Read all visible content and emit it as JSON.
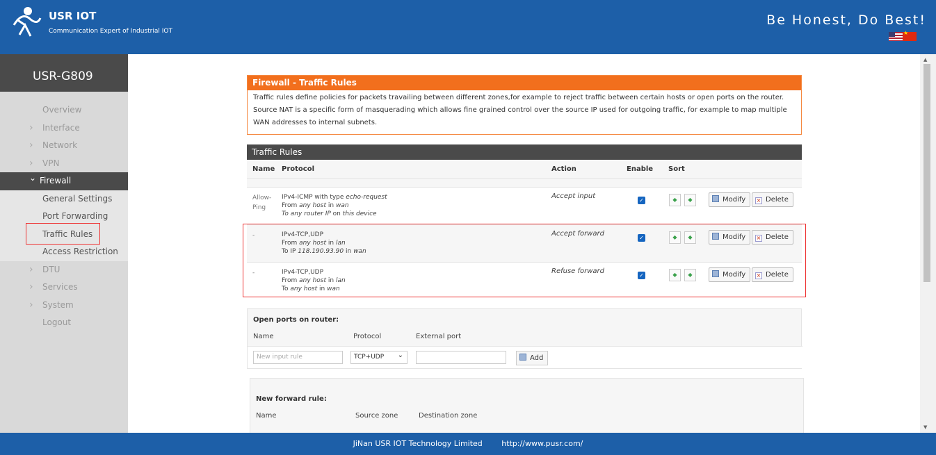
{
  "header": {
    "brand": "USR IOT",
    "subtitle": "Communication Expert of Industrial IOT",
    "slogan": "Be Honest, Do Best!"
  },
  "sidebar": {
    "device": "USR-G809",
    "items": [
      {
        "label": "Overview"
      },
      {
        "label": "Interface"
      },
      {
        "label": "Network"
      },
      {
        "label": "VPN"
      },
      {
        "label": "Firewall"
      }
    ],
    "firewall_sub": [
      {
        "label": "General Settings"
      },
      {
        "label": "Port Forwarding"
      },
      {
        "label": "Traffic Rules"
      },
      {
        "label": "Access Restriction"
      }
    ],
    "items_after": [
      {
        "label": "DTU"
      },
      {
        "label": "Services"
      },
      {
        "label": "System"
      },
      {
        "label": "Logout"
      }
    ]
  },
  "firewall": {
    "title": "Firewall - Traffic Rules",
    "desc1": "Traffic rules define policies for packets travailing between different zones,for example to reject traffic between certain hosts or open ports on the router.",
    "desc2": "Source NAT is a specific form of masquerading which allows fine grained control over the source IP used for outgoing traffic, for example to map multiple WAN addresses to internal subnets."
  },
  "traffic_rules": {
    "title": "Traffic Rules",
    "headers": {
      "name": "Name",
      "protocol": "Protocol",
      "action": "Action",
      "enable": "Enable",
      "sort": "Sort"
    },
    "rows": [
      {
        "name1": "Allow-",
        "name2": "Ping",
        "p1": "IPv4-ICMP with type ",
        "p1i": "echo-request",
        "p2": "From ",
        "p2i": "any host",
        "p2b": " in ",
        "p2c": "wan",
        "p3a": "To ",
        "p3i": "any router IP",
        "p3b": " on ",
        "p3c": "this device",
        "action": "Accept input"
      },
      {
        "name1": "-",
        "name2": "",
        "p1": "IPv4-TCP,UDP",
        "p1i": "",
        "p2": "From ",
        "p2i": "any host",
        "p2b": " in ",
        "p2c": "lan",
        "p3a": "To IP ",
        "p3i": "118.190.93.90",
        "p3b": " in ",
        "p3c": "wan",
        "action": "Accept forward"
      },
      {
        "name1": "-",
        "name2": "",
        "p1": "IPv4-TCP,UDP",
        "p1i": "",
        "p2": "From ",
        "p2i": "any host",
        "p2b": " in ",
        "p2c": "lan",
        "p3a": "To ",
        "p3i": "any host",
        "p3b": " in ",
        "p3c": "wan",
        "action": "Refuse forward"
      }
    ],
    "modify_label": "Modify",
    "delete_label": "Delete"
  },
  "open_ports": {
    "title": "Open ports on router:",
    "col_name": "Name",
    "col_protocol": "Protocol",
    "col_port": "External port",
    "name_placeholder": "New input rule",
    "protocol_value": "TCP+UDP",
    "add_label": "Add"
  },
  "new_forward": {
    "title": "New forward rule:",
    "col_name": "Name",
    "col_src": "Source zone",
    "col_dst": "Destination zone"
  },
  "footer": {
    "company": "JiNan USR IOT Technology Limited",
    "url": "http://www.pusr.com/"
  }
}
